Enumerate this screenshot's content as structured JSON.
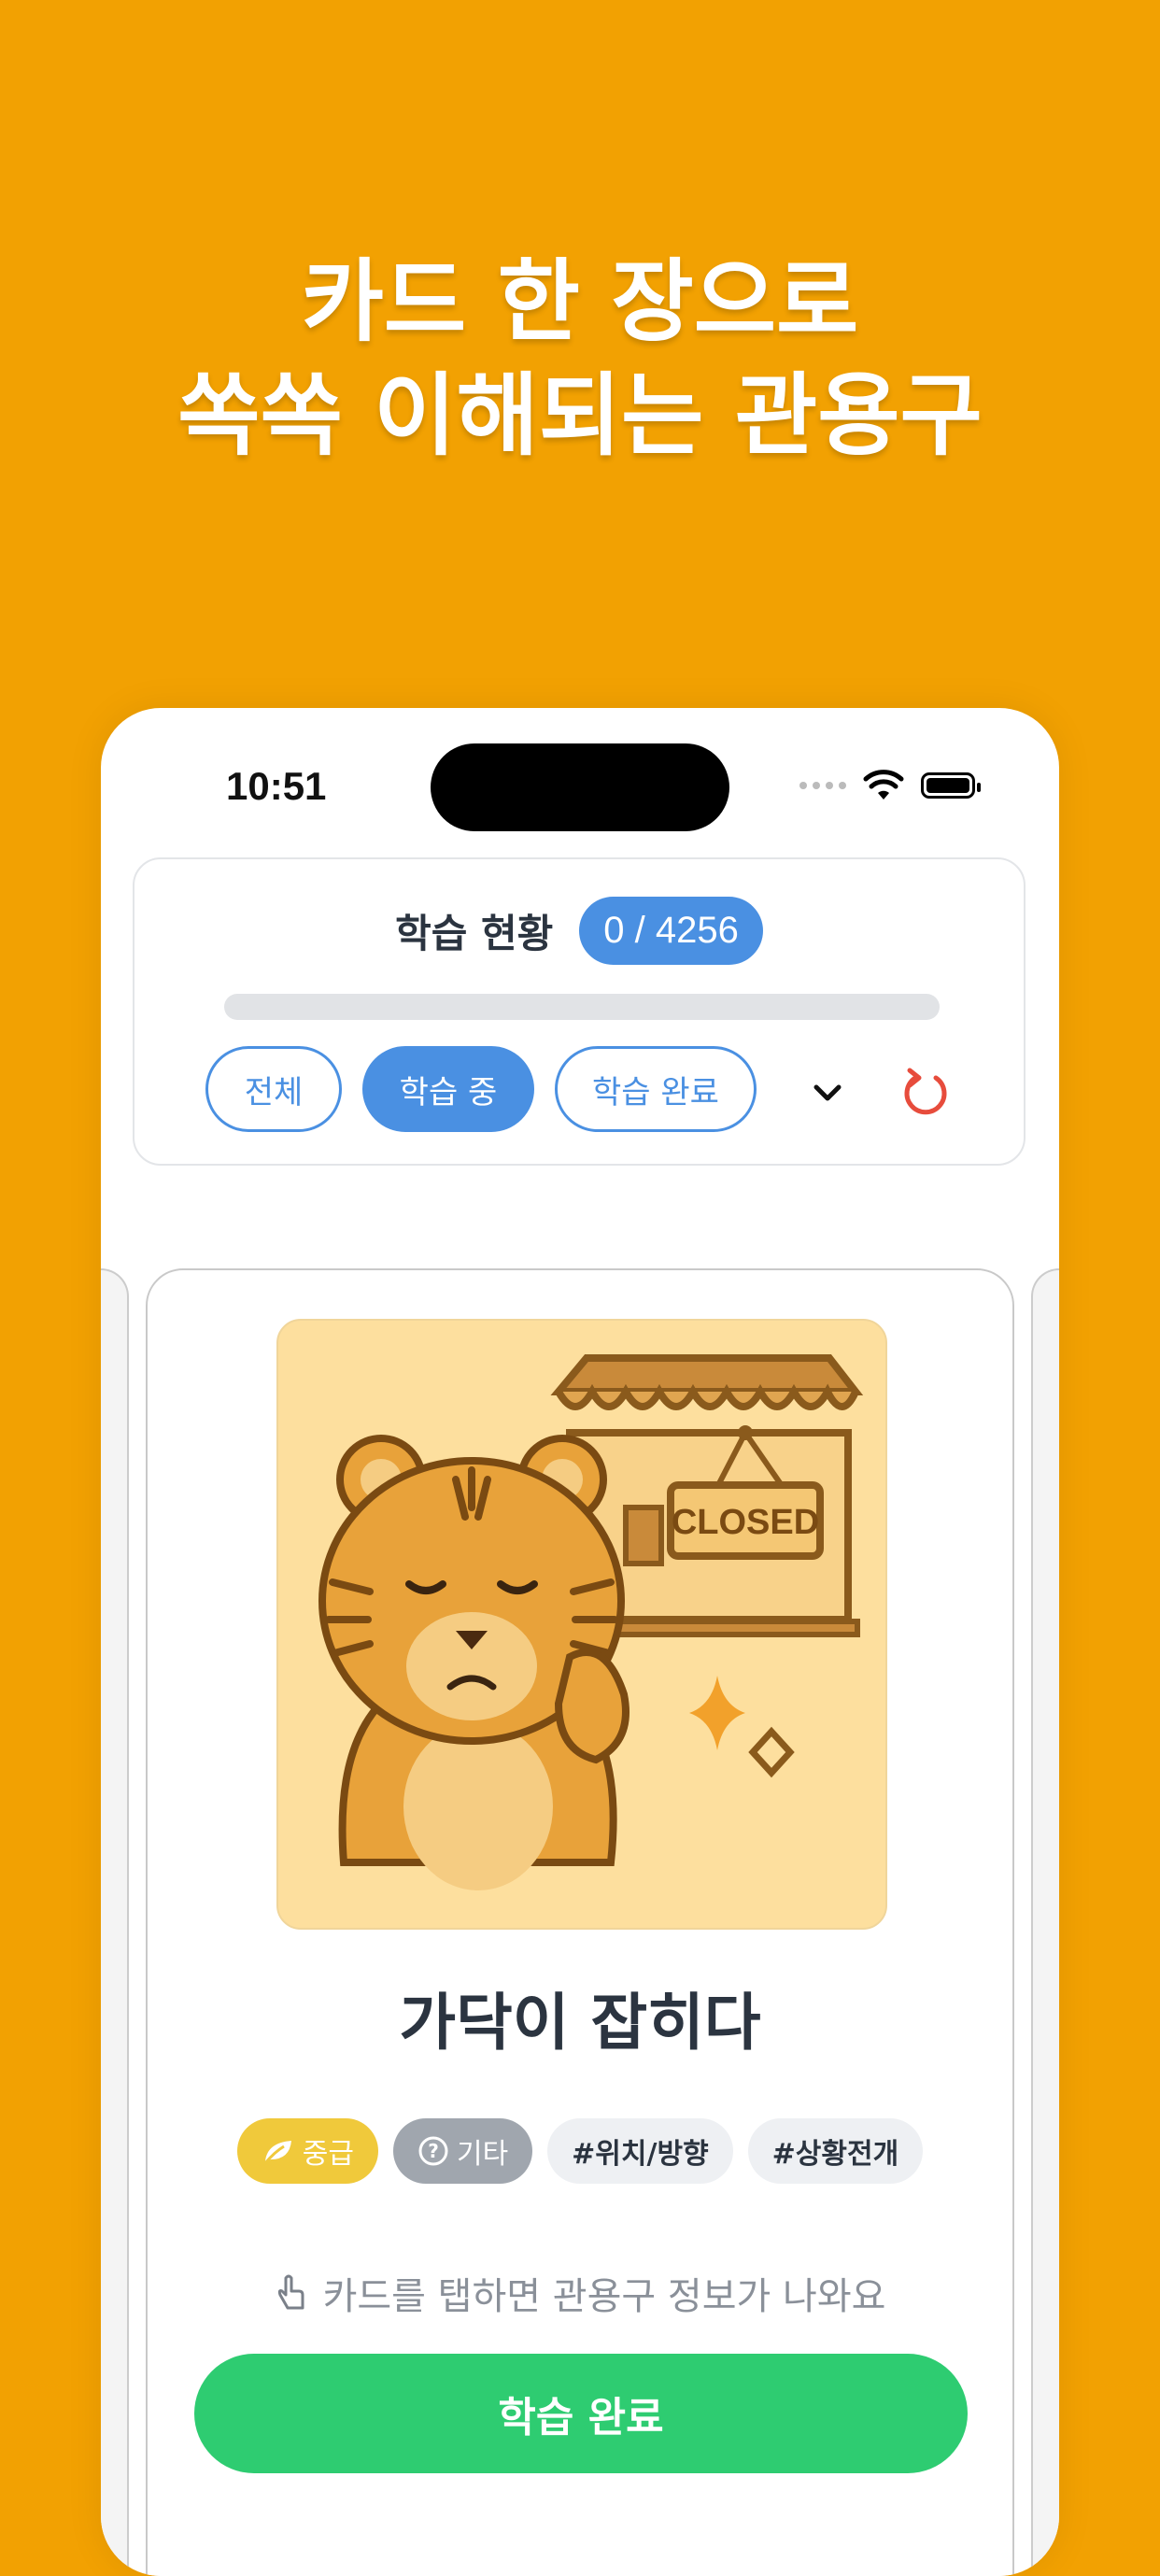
{
  "promo": {
    "line1": "카드 한 장으로",
    "line2": "쏙쏙 이해되는 관용구"
  },
  "status_bar": {
    "time": "10:51"
  },
  "progress": {
    "label": "학습 현황",
    "count": "0 / 4256",
    "fraction": 0,
    "accent_color": "#4A90E2"
  },
  "filters": [
    {
      "label": "전체",
      "active": false
    },
    {
      "label": "학습 중",
      "active": true
    },
    {
      "label": "학습 완료",
      "active": false
    }
  ],
  "card": {
    "illustration_text": "CLOSED",
    "word": "가닥이 잡히다",
    "tags": {
      "level": "중급",
      "category": "기타",
      "hashtag1": "#위치/방향",
      "hashtag2": "#상황전개"
    },
    "hint": "카드를 탭하면 관용구 정보가 나와요",
    "done_button": "학습 완료"
  },
  "colors": {
    "background": "#F2A102",
    "primary": "#4A90E2",
    "success": "#2ECC71",
    "reset": "#E74C3C"
  },
  "icons": {
    "status": [
      "signal-dots-icon",
      "wifi-icon",
      "battery-icon"
    ],
    "dropdown": "chevron-down-icon",
    "reset": "reset-icon",
    "level": "leaf-icon",
    "category": "question-circle-icon",
    "hint": "tap-hand-icon"
  }
}
